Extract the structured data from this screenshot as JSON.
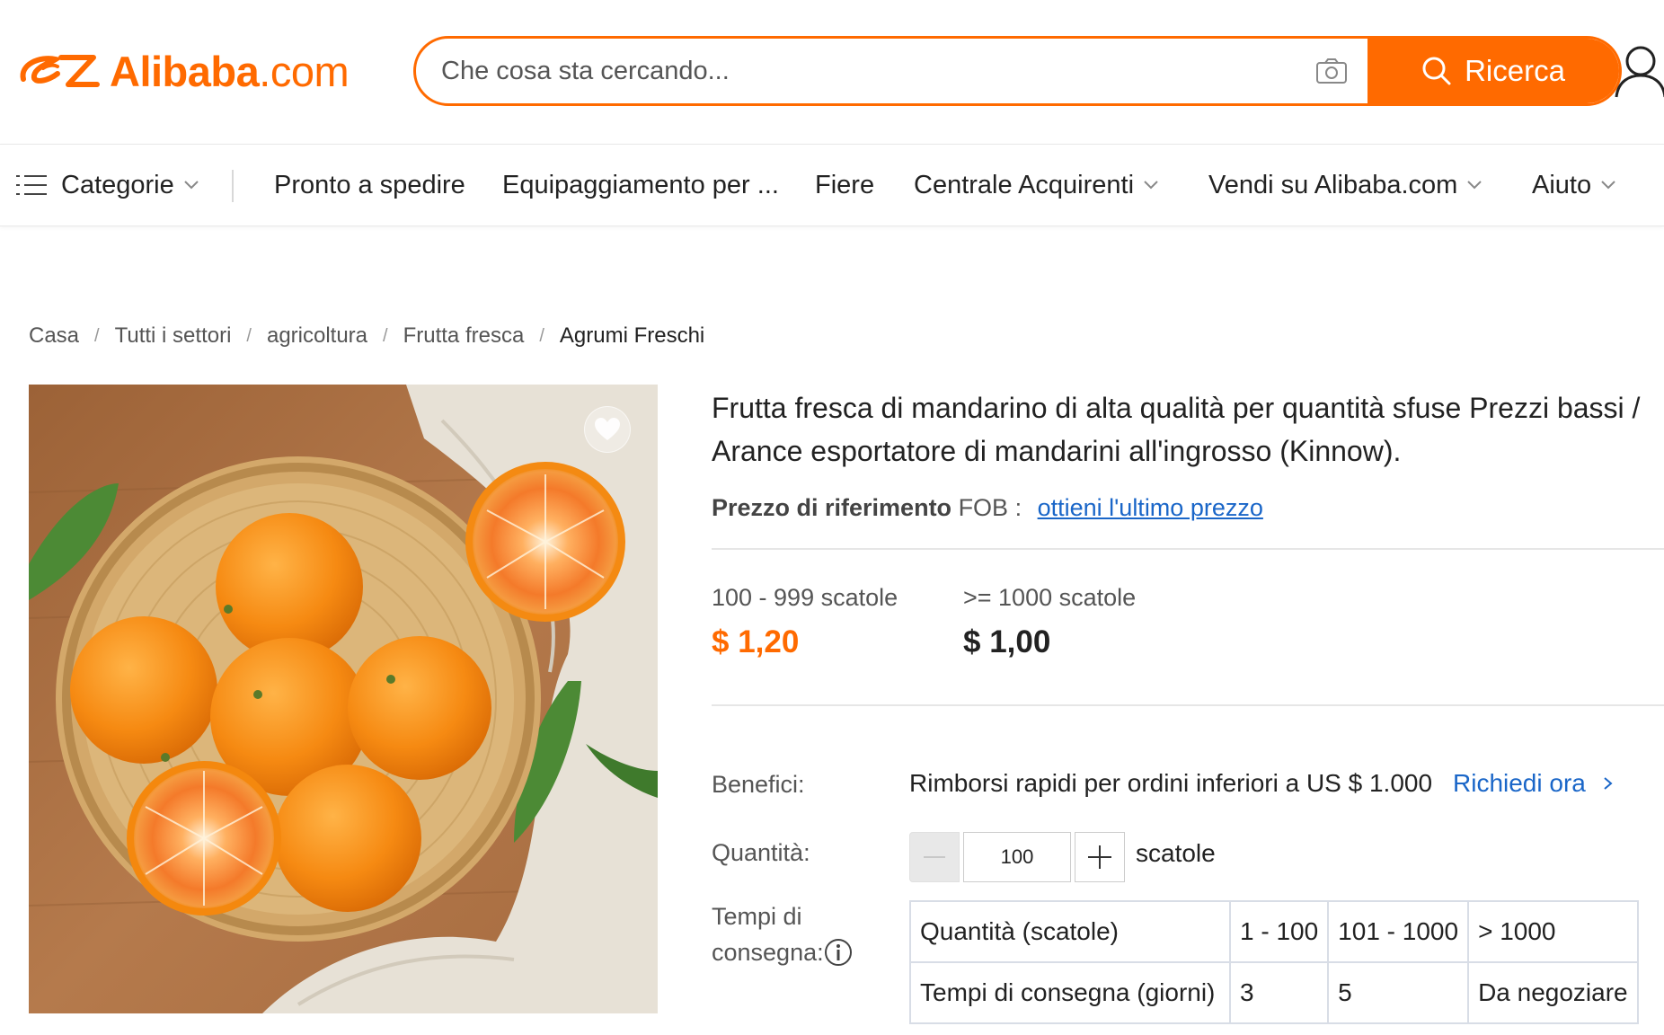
{
  "header": {
    "logo_text": "Alibaba",
    "logo_domain": ".com",
    "search_placeholder": "Che cosa sta cercando...",
    "search_button_label": "Ricerca"
  },
  "nav": {
    "categories_label": "Categorie",
    "items": [
      "Pronto a spedire",
      "Equipaggiamento per ...",
      "Fiere",
      "Centrale Acquirenti",
      "Vendi su Alibaba.com",
      "Aiuto"
    ]
  },
  "breadcrumb": [
    "Casa",
    "Tutti i settori",
    "agricoltura",
    "Frutta fresca",
    "Agrumi Freschi"
  ],
  "product": {
    "title": "Frutta fresca di mandarino di alta qualità per quantità sfuse Prezzi bassi / Arance esportatore di mandarini all'ingrosso (Kinnow).",
    "reference_label": "Prezzo di riferimento",
    "reference_term": "FOB :",
    "reference_link": "ottieni l'ultimo prezzo",
    "price_tiers": [
      {
        "quantity": "100 - 999 scatole",
        "price": "$ 1,20",
        "color": "#ff6a00"
      },
      {
        "quantity": ">= 1000 scatole",
        "price": "$ 1,00",
        "color": "#222222"
      }
    ],
    "benefits_label": "Benefici:",
    "benefits_text": "Rimborsi rapidi per ordini inferiori a US $ 1.000",
    "benefits_link": "Richiedi ora",
    "quantity_label": "Quantità:",
    "quantity_value": "100",
    "quantity_unit": "scatole",
    "lead_time_label_line1": "Tempi di",
    "lead_time_label_line2": "consegna:",
    "lead_time_table": {
      "rows": [
        [
          "Quantità (scatole)",
          "1 - 100",
          "101 - 1000",
          "> 1000"
        ],
        [
          "Tempi di consegna (giorni)",
          "3",
          "5",
          "Da negoziare"
        ]
      ]
    }
  },
  "colors": {
    "brand": "#ff6a00",
    "link": "#1a66c8"
  }
}
